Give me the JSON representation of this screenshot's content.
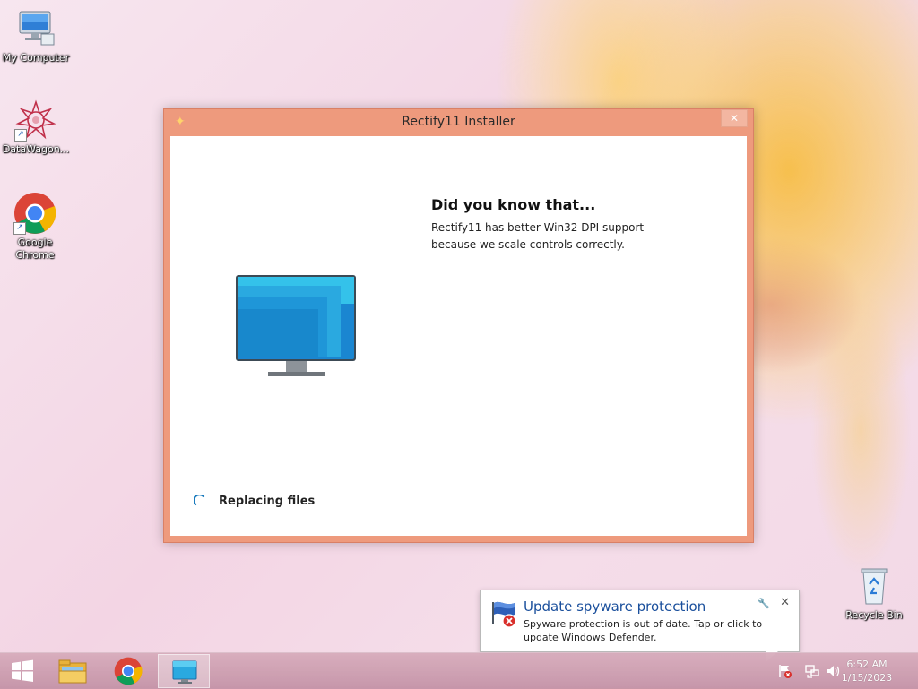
{
  "desktop": {
    "icons": [
      {
        "label": "My Computer"
      },
      {
        "label": "DataWagon..."
      },
      {
        "label": "Google Chrome"
      },
      {
        "label": "Recycle Bin"
      }
    ]
  },
  "installer": {
    "title": "Rectify11 Installer",
    "close_glyph": "✕",
    "did_you_know_title": "Did you know that...",
    "did_you_know_body": "Rectify11 has better Win32 DPI support because we scale controls correctly.",
    "status": "Replacing files"
  },
  "notification": {
    "title": "Update spyware protection",
    "body": "Spyware protection is out of date. Tap or click to update Windows Defender.",
    "icon": "defender-flag-error-icon"
  },
  "taskbar": {
    "pinned": [
      {
        "name": "start-button",
        "icon": "windows-logo-icon"
      },
      {
        "name": "file-explorer",
        "icon": "folder-icon"
      },
      {
        "name": "google-chrome",
        "icon": "chrome-icon"
      },
      {
        "name": "rectify11-installer",
        "icon": "installer-icon",
        "active": true
      }
    ],
    "tray": [
      "action-center-flag-icon",
      "network-icon",
      "volume-icon"
    ],
    "clock_time": "6:52 AM",
    "clock_date": "1/15/2023"
  },
  "colors": {
    "window_border": "#ee9a7d",
    "notification_title": "#1a4f9c",
    "spinner": "#1a7bbd"
  }
}
